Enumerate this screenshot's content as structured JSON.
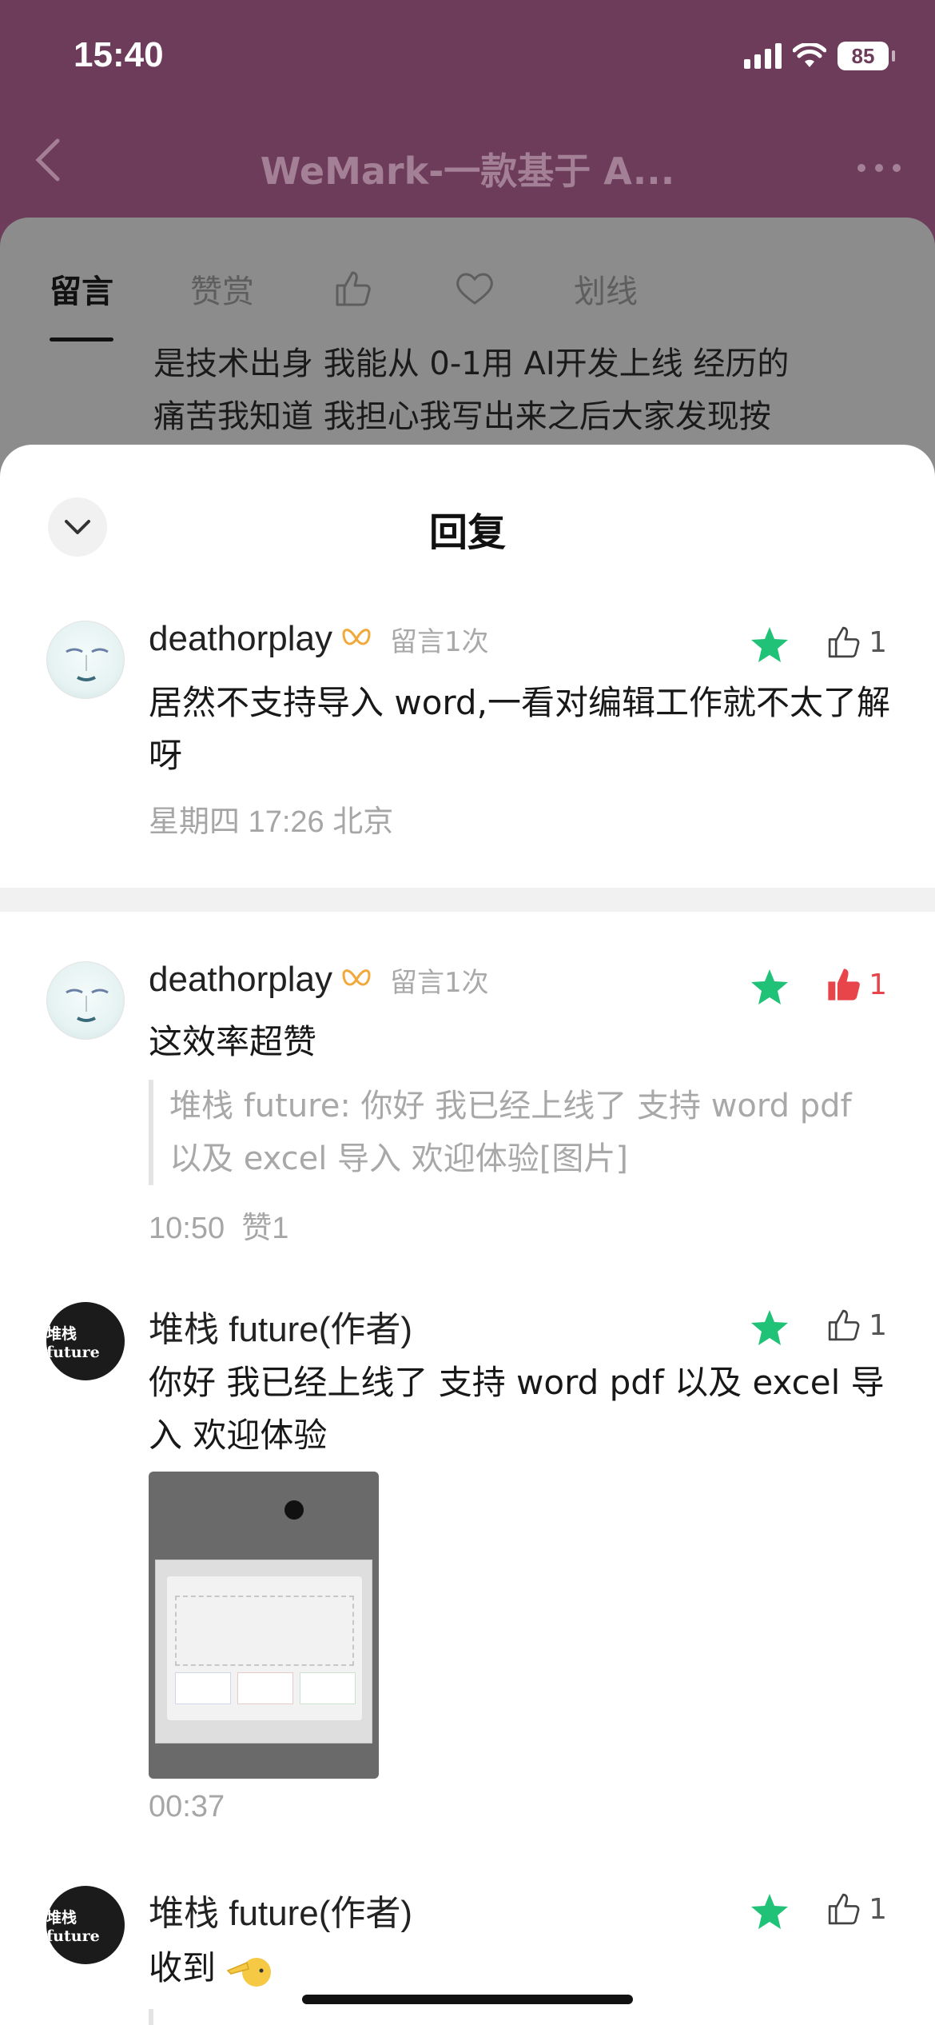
{
  "status_bar": {
    "time": "15:40",
    "battery": "85"
  },
  "nav": {
    "title": "WeMark-一款基于 A...",
    "back_icon": "chevron-left-icon",
    "more_icon": "more-icon"
  },
  "background_sheet": {
    "tabs": [
      "留言",
      "赞赏",
      "划线"
    ],
    "active_tab": "留言",
    "text_lines": [
      "是技术出身 我能从 0-1用 AI开发上线 经历的",
      "痛苦我知道 我担心我写出来之后大家发现按"
    ]
  },
  "sheet": {
    "title": "回复",
    "collapse_icon": "chevron-down-icon",
    "comments": [
      {
        "name": "deathorplay",
        "meta": "留言1次",
        "text": "居然不支持导入 word,一看对编辑工作就不太了解呀",
        "time_location": "星期四 17:26  北京",
        "likes": "1",
        "liked": false
      },
      {
        "name": "deathorplay",
        "meta": "留言1次",
        "text": "这效率超赞",
        "quote": "堆栈 future: 你好 我已经上线了 支持 word pdf 以及 excel 导入 欢迎体验[图片]",
        "time": "10:50",
        "likes_label": "赞1",
        "likes": "1",
        "liked": true
      },
      {
        "name": "堆栈 future(作者)",
        "avatar_text": "堆栈future",
        "text": "你好 我已经上线了 支持 word pdf 以及 excel 导入 欢迎体验",
        "time": "00:37",
        "likes": "1",
        "liked": false
      },
      {
        "name": "堆栈 future(作者)",
        "avatar_text": "堆栈future",
        "text": "收到",
        "likes": "1",
        "liked": false
      }
    ]
  },
  "colors": {
    "star": "#20c277",
    "like_red": "#e8454b",
    "header_bg": "#6d3c5a"
  }
}
